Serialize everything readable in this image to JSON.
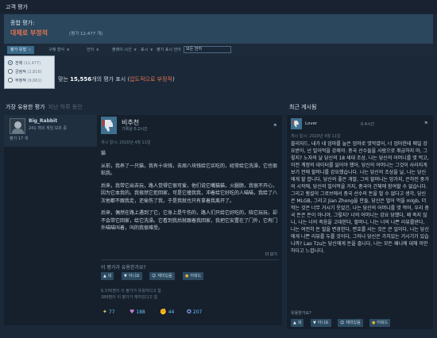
{
  "header": {
    "title": "고객 평가"
  },
  "overview": {
    "label": "종합 평가:",
    "verdict": "대체로 부정적",
    "count": "(평가 12,477 개)"
  },
  "filters": {
    "items": [
      {
        "label": "평가 유형",
        "active": true
      },
      {
        "label": "구매 형식"
      },
      {
        "label": "언어"
      },
      {
        "label": "플레이 시간"
      },
      {
        "label": "표시"
      }
    ],
    "language_label": "평가 표시 언어",
    "language_value": "모든 언어"
  },
  "dropdown": {
    "options": [
      {
        "label": "전체",
        "count": "(12,477)",
        "selected": true
      },
      {
        "label": "긍정적",
        "count": "(2,816)",
        "selected": false
      },
      {
        "label": "부정적",
        "count": "(9,661)",
        "selected": false
      }
    ]
  },
  "summary": {
    "prefix": "맞는",
    "count": "15,556",
    "middle": "개의 평가 표시 (",
    "verdict": "압도적으로 부정적",
    "suffix": ")"
  },
  "left_section": {
    "title": "가장 유용한 평가",
    "subtitle": "지난 하루 동안"
  },
  "review": {
    "user": {
      "name": "Big_Rabbit",
      "products": "241 개의 게임 보유 중",
      "reviews": "평가 17 개"
    },
    "verdict": "비추천",
    "hours": "기록상 0.2시간",
    "posted": "게시 일시: 2020년 4월 11일",
    "paragraphs": [
      "猫",
      "从前，我养了一只猫，我有十块钱，去周八块钱给它买吃的，经常给它洗澡，它也很粘我。",
      "后来，我带它出去玩，路人觉得它很可爱，他们说它嘴猫猫，火腿肠，我很不开心，因为它本我的。我很然它拒回家，可是它撞我我，冲着给它好吃的人喵喵，我给了八次他都不跟我走，还偷伤了我，于是我就也只有拿着我离开了。",
      "后来，偶然在路上遇到了它，它身上是牛伤的，路人们只给它好吃的，陪它玩玩，却不会带它回家，给它洗澡。它看到我后就跟着我回家，我把它安置在了门外，它有门外喵喵叫着，叫的我很难受。"
    ],
    "read_more": "더 보기",
    "helpful_question": "이 평가가 유용한가요?",
    "buttons": {
      "yes": "네",
      "no": "아니요",
      "funny": "재미있음",
      "award": "어워드"
    },
    "stats": [
      "6,376명이 이 평가가 유용하다고 함",
      "389명이 이 평가가 재미있다고 함"
    ],
    "awards": [
      {
        "icon": "wings-award-icon",
        "count": "77"
      },
      {
        "icon": "heart-hands-award-icon",
        "count": "188"
      },
      {
        "icon": "flex-award-icon",
        "count": "44"
      },
      {
        "icon": "medal-award-icon",
        "count": "207"
      }
    ]
  },
  "right_section": {
    "title": "최근 게시됨"
  },
  "recent": {
    "user": "Lover",
    "hours": "0.4시간",
    "date": "게시 일시: 2020년 4월 11일",
    "body": "블리자드, 내가 네 엄마를 늘은 엄마로 엿먹였어, 너 엄마한테 매일 강요받아, 넌 빌어먹을 강제야. 중국 선수들을 사람으로 취급하지 마, 그렇지? 노자의 날 당신의 18 세대 조상, 나는 당신의 어머니를 엿 먹고, 이전 계정의 데이터를 잃어야 했어, 당신의 어머니는 그것이 사라지게 보기 전에 할머니를 강요했습니다. 나는 당신의 조상을 날, 나는 당신에게 할 합니다, 당신의 좋은 개발, 그의 할머니는 망가지, 은하인 중가의 시작에, 당신의 빌어먹을 거지, 중국어 간체에 참여할 수 없습니다. 그리고 횡설이 그로브에서 중국 선수의 돈을 벌 수 없다고 생각, 당신은 MLGB, 그리고 Jian Zhong을 만들, 당신은 벌어 먹을 mlgb, 더 먹는 것은 너무 거시기 웃었긴, 나는 당신의 어머니를 엿 먹어, 우리 중국 돈은 돈이 아니야, 그렇지? 너의 어머니는 강요 당했다, 왜 죽지 않니, 나는 너의 죽음을 고대한다, 할머니, 나는 너의 나쁜 리뷰를받다, 나는 여전히 돈 벌을 변경한다, 변호를 사는 것은 큰 일이다, 나는 당신에게 나쁜 리뷰를 두를 것이다, 그러나 당신은 가치있는 거시기가 있습니까? Lao Tzu는 당신에게 돈을 줍니다, 나는 모든 패니에 대해 미안하다고 느낍니다.",
    "helpful_question": "유용한가요?",
    "buttons": {
      "yes": "네",
      "no": "아니요",
      "funny": "재미있음",
      "award": "어워드"
    }
  }
}
